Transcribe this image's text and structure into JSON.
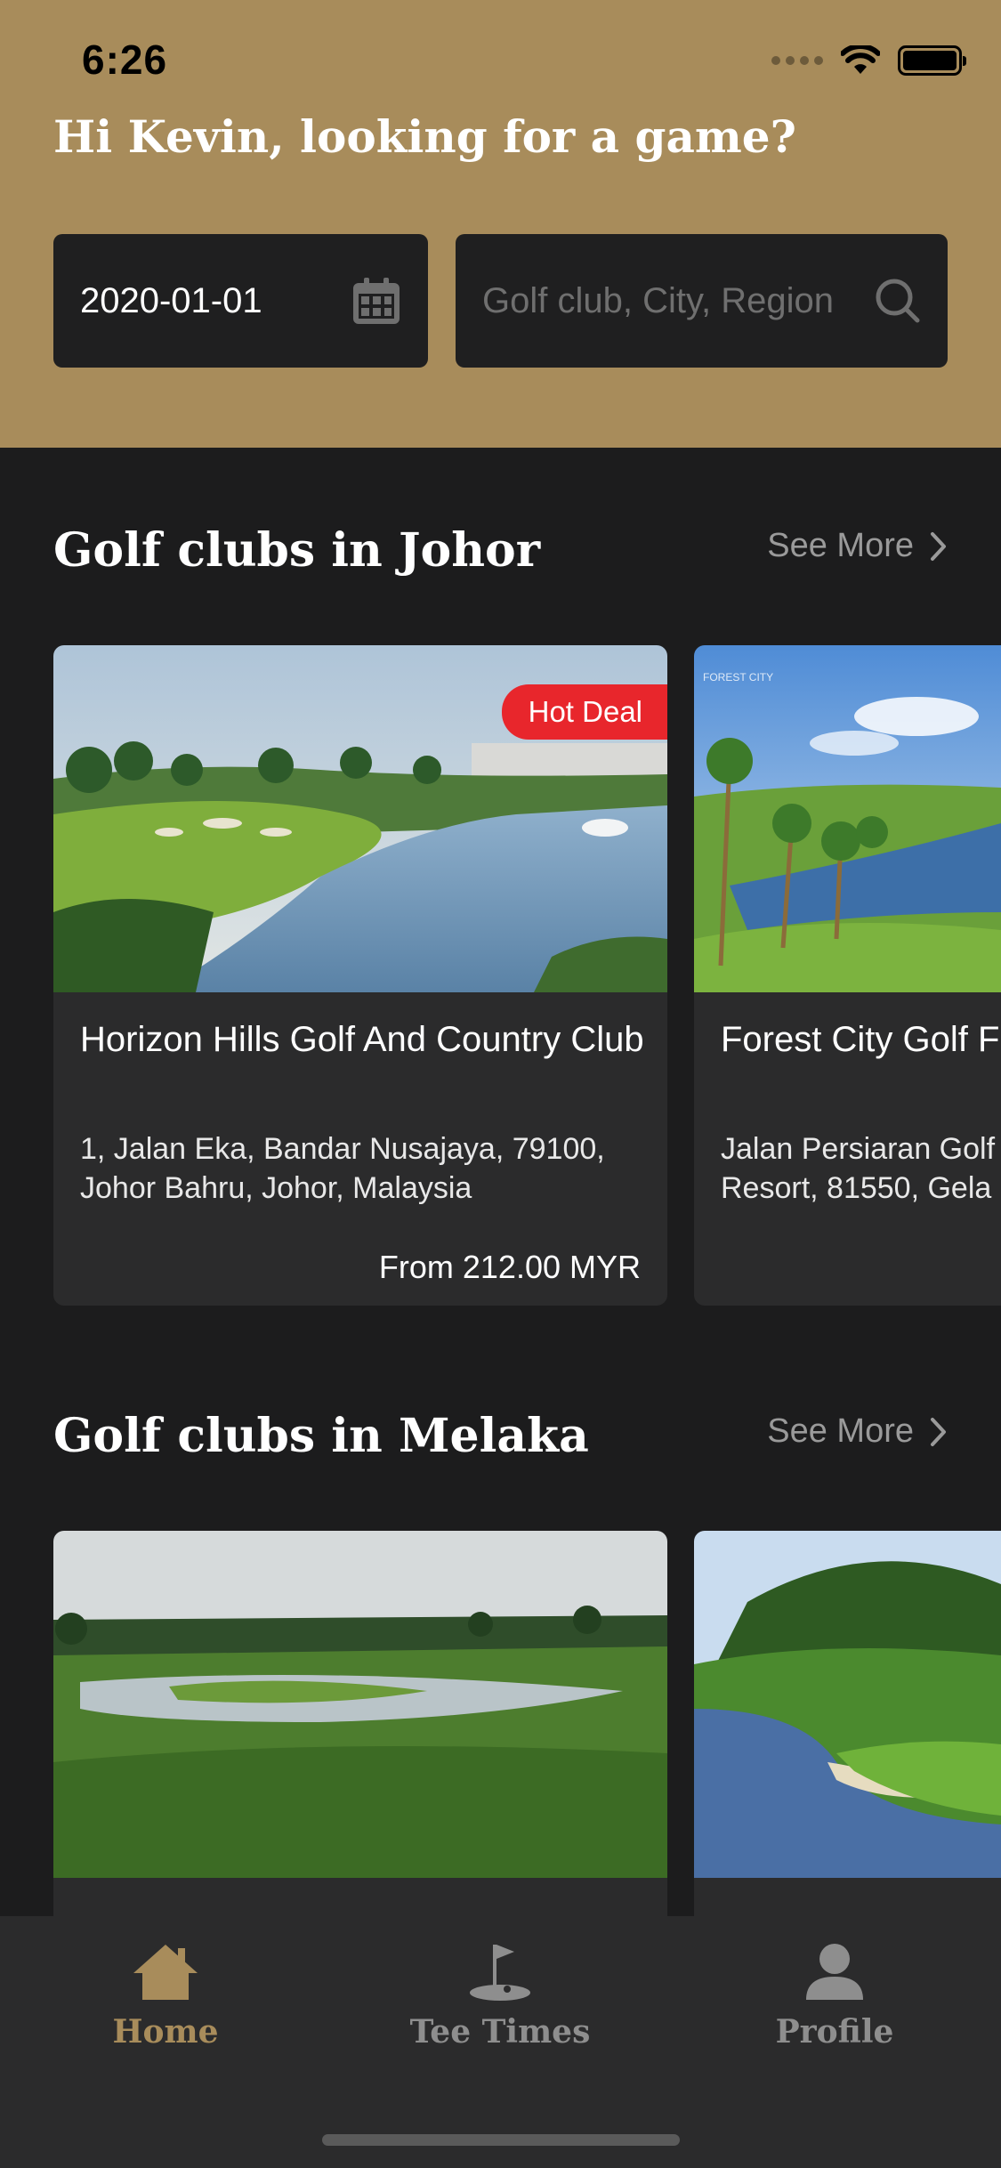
{
  "status_bar": {
    "time": "6:26"
  },
  "header": {
    "greeting": "Hi Kevin, looking for a game?",
    "date_value": "2020-01-01",
    "search_placeholder": "Golf club, City, Region"
  },
  "sections": [
    {
      "title": "Golf clubs in Johor",
      "see_more": "See More",
      "cards": [
        {
          "name": "Horizon Hills Golf And Country Club",
          "address": "1, Jalan Eka, Bandar Nusajaya, 79100, Johor Bahru, Johor, Malaysia",
          "price": "From 212.00 MYR",
          "badge": "Hot Deal"
        },
        {
          "name": "Forest City Golf F",
          "address": "Jalan Persiaran Golf Resort, 81550, Gela"
        }
      ]
    },
    {
      "title": "Golf clubs in Melaka",
      "see_more": "See More",
      "cards": [
        {
          "name": ""
        },
        {
          "name": ""
        }
      ]
    }
  ],
  "tabbar": {
    "home": "Home",
    "tee_times": "Tee Times",
    "profile": "Profile",
    "active_tab": "Home"
  },
  "colors": {
    "brand_gold": "#a88c5b",
    "background": "#1c1c1d",
    "card": "#2b2b2c",
    "badge_red": "#e8262c"
  },
  "icons": [
    "calendar-icon",
    "search-icon",
    "chevron-right-icon",
    "home-icon",
    "golf-flag-icon",
    "person-icon",
    "wifi-icon",
    "battery-icon"
  ]
}
